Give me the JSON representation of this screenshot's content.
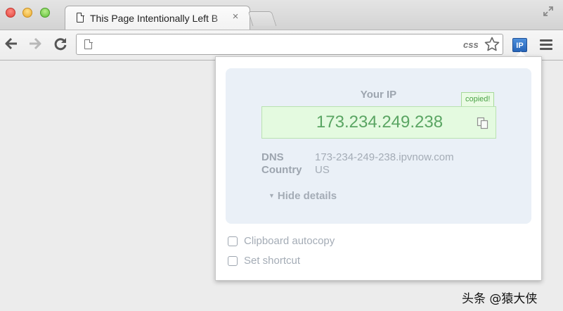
{
  "browser": {
    "tab_title": "This Page Intentionally Left B",
    "tab_close": "×",
    "omnibox_value": "",
    "omnibox_css_label": "css",
    "extension_label": "IP",
    "icons": {
      "tab": "page-icon",
      "back": "back-arrow-icon",
      "forward": "forward-arrow-icon",
      "reload": "reload-icon",
      "bookmark": "star-icon",
      "menu": "hamburger-menu-icon",
      "fullscreen": "fullscreen-icon"
    }
  },
  "popup": {
    "your_ip_label": "Your IP",
    "copied_badge": "copied!",
    "ip_address": "173.234.249.238",
    "details": [
      {
        "key": "DNS",
        "value": "173-234-249-238.ipvnow.com"
      },
      {
        "key": "Country",
        "value": "US"
      }
    ],
    "hide_details": "Hide details",
    "options": [
      {
        "label": "Clipboard autocopy",
        "checked": false
      },
      {
        "label": "Set shortcut",
        "checked": false
      }
    ],
    "colors": {
      "ip_text": "#5aa563",
      "ip_box_bg": "#e4fae0",
      "panel_bg": "#eaf0f7",
      "extension_blue": "#2764b8"
    }
  },
  "watermark": "头条 @猿大侠"
}
